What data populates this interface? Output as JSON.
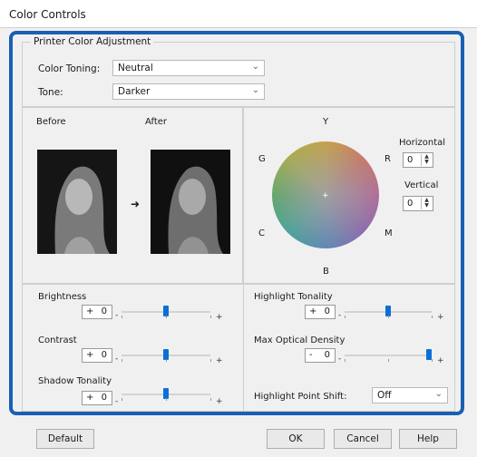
{
  "window": {
    "title": "Color Controls"
  },
  "adjustment": {
    "group_title": "Printer Color Adjustment",
    "color_toning_label": "Color Toning:",
    "color_toning_value": "Neutral",
    "tone_label": "Tone:",
    "tone_value": "Darker"
  },
  "preview": {
    "before_label": "Before",
    "after_label": "After"
  },
  "wheel": {
    "labels": {
      "top": "Y",
      "left_top": "G",
      "right_top": "R",
      "left_bottom": "C",
      "right_bottom": "M",
      "bottom": "B"
    },
    "horizontal_label": "Horizontal",
    "horizontal_value": "0",
    "vertical_label": "Vertical",
    "vertical_value": "0"
  },
  "sliders": [
    {
      "label": "Brightness",
      "sign": "+",
      "value": "0",
      "position": 0.5
    },
    {
      "label": "Contrast",
      "sign": "+",
      "value": "0",
      "position": 0.5
    },
    {
      "label": "Shadow Tonality",
      "sign": "+",
      "value": "0",
      "position": 0.5
    },
    {
      "label": "Highlight Tonality",
      "sign": "+",
      "value": "0",
      "position": 0.5
    },
    {
      "label": "Max Optical Density",
      "sign": "-",
      "value": "0",
      "position": 0.97
    }
  ],
  "highlight_point_shift": {
    "label": "Highlight Point Shift:",
    "value": "Off"
  },
  "buttons": {
    "default": "Default",
    "ok": "OK",
    "cancel": "Cancel",
    "help": "Help"
  },
  "colors": {
    "accent": "#1a5fb4",
    "slider_thumb": "#0b6fd8"
  }
}
